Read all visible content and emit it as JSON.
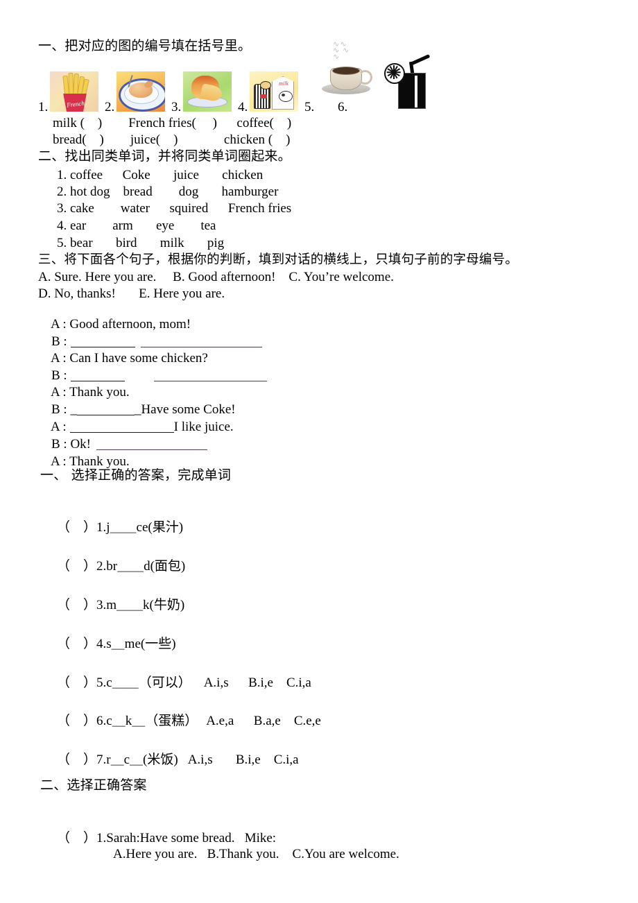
{
  "document": {
    "type": "primary-english-worksheet"
  },
  "section1": {
    "heading": "一、把对应的图的编号填在括号里。",
    "pictures": [
      {
        "num": "1.",
        "icon": "french-fries-image",
        "caption": "French"
      },
      {
        "num": "2.",
        "icon": "roast-chicken-image",
        "caption": ""
      },
      {
        "num": "3.",
        "icon": "bread-image",
        "caption": ""
      },
      {
        "num": "4.",
        "icon": "milk-carton-image",
        "caption": "milk"
      },
      {
        "num": "5.",
        "icon": "coffee-cup-image",
        "caption": ""
      },
      {
        "num": "6.",
        "icon": "juice-glass-image",
        "caption": ""
      }
    ],
    "answer_line_1": "milk (    )        French fries(     )      coffee(    )",
    "answer_line_2": "bread(    )        juice(    )              chicken (    )"
  },
  "section2": {
    "heading": "二、找出同类单词，并将同类单词圈起来。",
    "rows": [
      "1. coffee      Coke       juice       chicken",
      "2. hot dog    bread        dog       hamburger",
      "3. cake        water      squired      French fries",
      "4. ear        arm       eye        tea",
      "5. bear       bird       milk       pig"
    ]
  },
  "section3": {
    "heading": "三、将下面各个句子，根据你的判断，填到对话的横线上，只填句子前的字母编号。",
    "options_line_1": "A. Sure. Here you are.     B. Good afternoon!    C. You’re welcome.",
    "options_line_2": "D. No, thanks!       E. Here you are.",
    "dialog": [
      {
        "speaker": "A :",
        "text": "Good afternoon, mom!"
      },
      {
        "speaker": "B :",
        "text": ""
      },
      {
        "speaker": "A :",
        "text": "Can I have some chicken?"
      },
      {
        "speaker": "B :",
        "text": ""
      },
      {
        "speaker": "A :",
        "text": "Thank you."
      },
      {
        "speaker": "B :",
        "text": "Have some Coke!"
      },
      {
        "speaker": "A :",
        "text": "I like juice."
      },
      {
        "speaker": "B :",
        "text": "Ok!"
      },
      {
        "speaker": "A :",
        "text": "Thank you."
      }
    ]
  },
  "section4": {
    "heading": "一、  选择正确的答案，完成单词",
    "questions": [
      {
        "bracket": "（    ）",
        "text": "1.j＿＿ce(果汁)",
        "choices": ""
      },
      {
        "bracket": "（    ）",
        "text": "2.br＿＿d(面包)",
        "choices": ""
      },
      {
        "bracket": "（    ）",
        "text": "3.m＿＿k(牛奶)",
        "choices": ""
      },
      {
        "bracket": "（    ）",
        "text": "4.s＿me(一些)",
        "choices": ""
      },
      {
        "bracket": "（    ）",
        "text": "5.c＿＿（可以）",
        "choices": "A.i,s      B.i,e    C.i,a"
      },
      {
        "bracket": "（    ）",
        "text": "6.c＿k＿（蛋糕）",
        "choices": "A.e,a      B.a,e    C.e,e"
      },
      {
        "bracket": "（    ）",
        "text": "7.r＿c＿(米饭)",
        "choices": "A.i,s       B.i,e    C.i,a"
      }
    ]
  },
  "section5": {
    "heading": "二、选择正确答案",
    "question_bracket": "（    ）",
    "question_text": "1.Sarah:Have some bread.   Mike:",
    "choices": "A.Here you are.   B.Thank you.    C.You are welcome."
  }
}
